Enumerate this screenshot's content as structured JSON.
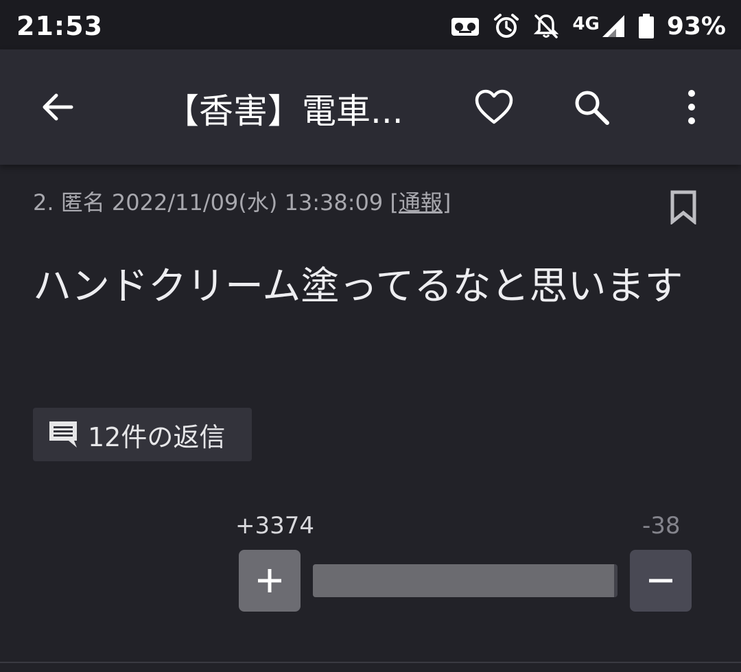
{
  "status": {
    "time": "21:53",
    "network": "4G",
    "battery": "93%"
  },
  "app_bar": {
    "title": "【香害】電車..."
  },
  "post": {
    "number": "2.",
    "author": "匿名",
    "date": "2022/11/09(水) 13:38:09",
    "report_label": "[通報]",
    "body": "ハンドクリーム塗ってるなと思います",
    "reply_label": "12件の返信",
    "votes": {
      "plus": "+3374",
      "minus": "-38",
      "plus_ratio": 0.9889
    }
  },
  "colors": {
    "background": "#222228",
    "app_bar": "#2b2b33",
    "status_bar": "#1b1b20",
    "plus_button": "#6c6c72",
    "minus_button": "#494954"
  }
}
